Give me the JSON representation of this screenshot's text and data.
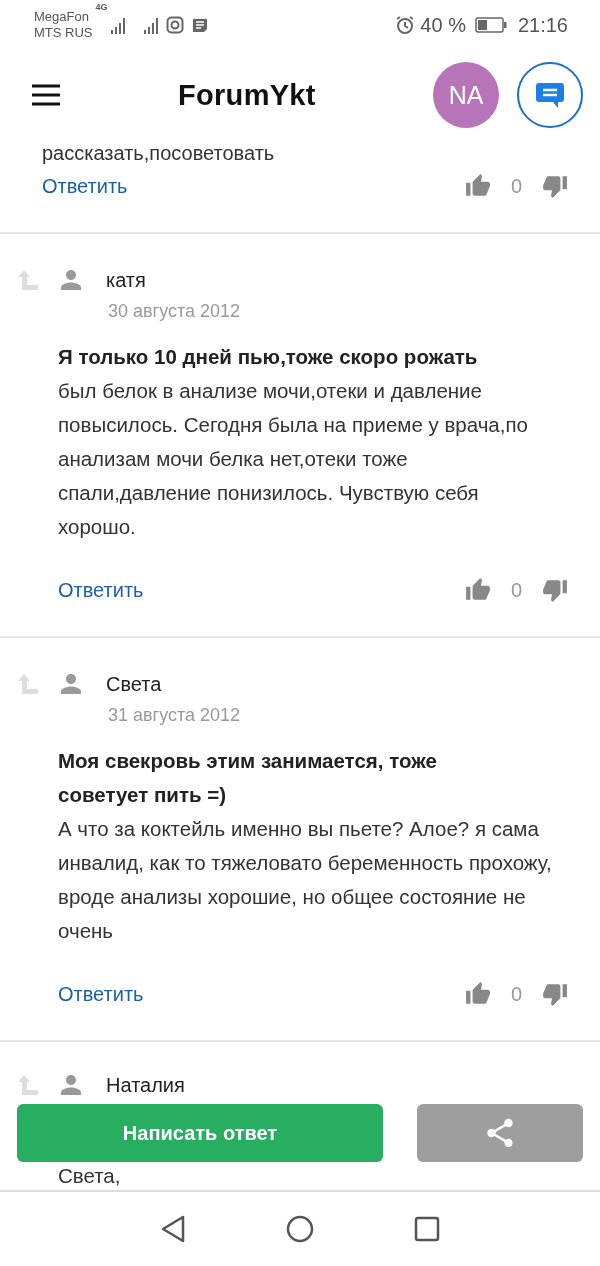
{
  "status_bar": {
    "carrier_1": "MegaFon",
    "carrier_2": "MTS RUS",
    "network": "4G",
    "battery": "40 %",
    "time": "21:16"
  },
  "header": {
    "logo": "ForumYkt",
    "avatar": "NA"
  },
  "posts": [
    {
      "kind": "tail",
      "body": "рассказать,посоветовать",
      "reply": "Ответить",
      "votes": "0"
    },
    {
      "kind": "comment",
      "author": "катя",
      "date": "30 августа 2012",
      "lead": "Я только 10 дней пью,тоже скоро рожать",
      "body": "был белок в анализе мочи,отеки и давление повысилось. Сегодня была на приеме у врача,по анализам мочи белка нет,отеки тоже спали,давление понизилось. Чувствую себя хорошо.",
      "reply": "Ответить",
      "votes": "0"
    },
    {
      "kind": "comment",
      "author": "Света",
      "date": "31 августа 2012",
      "lead": "Моя свекровь этим занимается, тоже советует пить =)",
      "body": "А что за коктейль именно вы пьете? Алое? я сама инвалид, как то тяжеловато беременность прохожу, вроде анализы хорошие, но общее состояние не очень",
      "reply": "Ответить",
      "votes": "0"
    },
    {
      "kind": "partial",
      "author": "Наталия",
      "body": "Света,"
    }
  ],
  "actions": {
    "write": "Написать ответ"
  }
}
